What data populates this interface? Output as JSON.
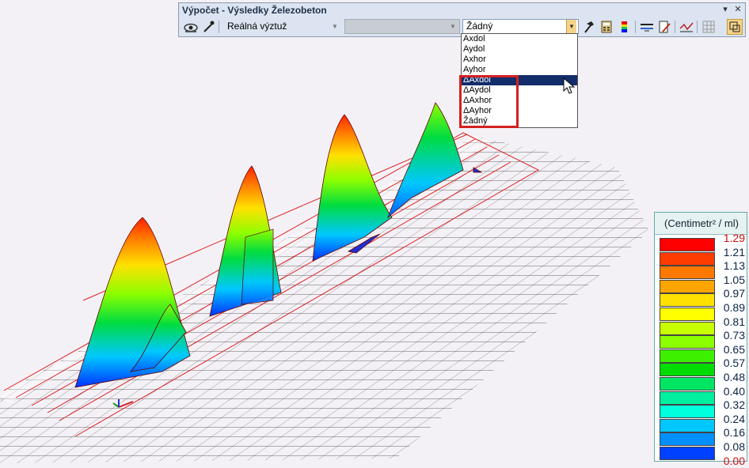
{
  "window": {
    "title": "Výpočet - Výsledky Železobeton",
    "pin_icon": "▾",
    "close_icon": "✕"
  },
  "toolbar": {
    "select_reinforcement": "Reálná výztuž",
    "select_second": "",
    "select_result": "Žádný",
    "icons": [
      "eye-settings-icon",
      "pipette-icon",
      "hammer-icon",
      "calculator-icon",
      "color-scale-icon",
      "filter-icon",
      "document-edit-icon",
      "diagram-icon",
      "grid-icon",
      "select-mode-icon"
    ]
  },
  "dropdown": {
    "options": [
      "Axdol",
      "Aydol",
      "Axhor",
      "Ayhor",
      "ΔAxdol",
      "ΔAydol",
      "ΔAxhor",
      "ΔAyhor",
      "Žádný"
    ],
    "selected_index": 4
  },
  "legend": {
    "unit": "(Centimetr² / ml)",
    "values": [
      "1.29",
      "1.21",
      "1.13",
      "1.05",
      "0.97",
      "0.89",
      "0.81",
      "0.73",
      "0.65",
      "0.57",
      "0.48",
      "0.40",
      "0.32",
      "0.24",
      "0.16",
      "0.08",
      "0.00"
    ],
    "colors": [
      "#ff0000",
      "#ff3c00",
      "#ff7800",
      "#ffa500",
      "#ffe100",
      "#ffff00",
      "#c8ff00",
      "#8cff00",
      "#3cf000",
      "#00dc00",
      "#00e664",
      "#00f0a0",
      "#00ffdc",
      "#00c8ff",
      "#0090ff",
      "#0040ff",
      "#0000ff"
    ]
  }
}
